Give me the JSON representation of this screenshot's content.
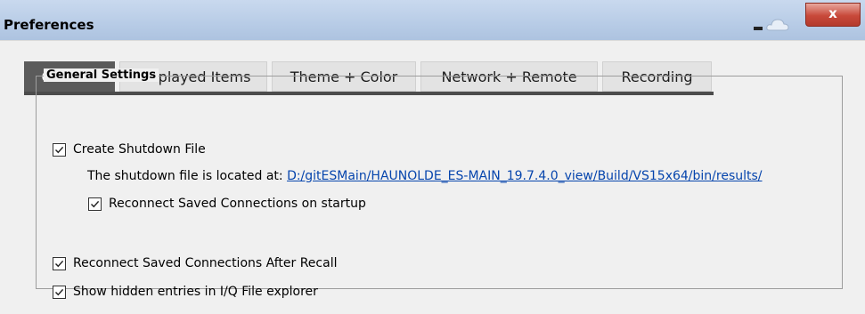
{
  "window": {
    "title": "Preferences",
    "close_symbol": "x"
  },
  "tabs": [
    {
      "label": "General",
      "active": true
    },
    {
      "label": "Displayed Items",
      "active": false
    },
    {
      "label": "Theme + Color",
      "active": false
    },
    {
      "label": "Network + Remote",
      "active": false
    },
    {
      "label": "Recording",
      "active": false
    }
  ],
  "general_settings": {
    "legend": "General Settings",
    "create_shutdown_file": {
      "label": "Create Shutdown File",
      "checked": true
    },
    "shutdown_location_label": "The shutdown file is located at:",
    "shutdown_location_link": "D:/gitESMain/HAUNOLDE_ES-MAIN_19.7.4.0_view/Build/VS15x64/bin/results/",
    "reconnect_on_startup": {
      "label": "Reconnect Saved Connections on startup",
      "checked": true
    },
    "reconnect_after_recall": {
      "label": "Reconnect Saved Connections After Recall",
      "checked": true
    },
    "show_hidden_entries": {
      "label": "Show hidden entries in I/Q File explorer",
      "checked": true
    }
  },
  "colors": {
    "active_tab": "#5b5b5b",
    "titlebar": "#b9cde7",
    "close_button": "#c8493a",
    "link": "#0645ad"
  },
  "icons": {
    "minimize": "minimize-icon",
    "cloud": "cloud-icon",
    "close": "close-icon",
    "check": "checkmark-icon"
  }
}
